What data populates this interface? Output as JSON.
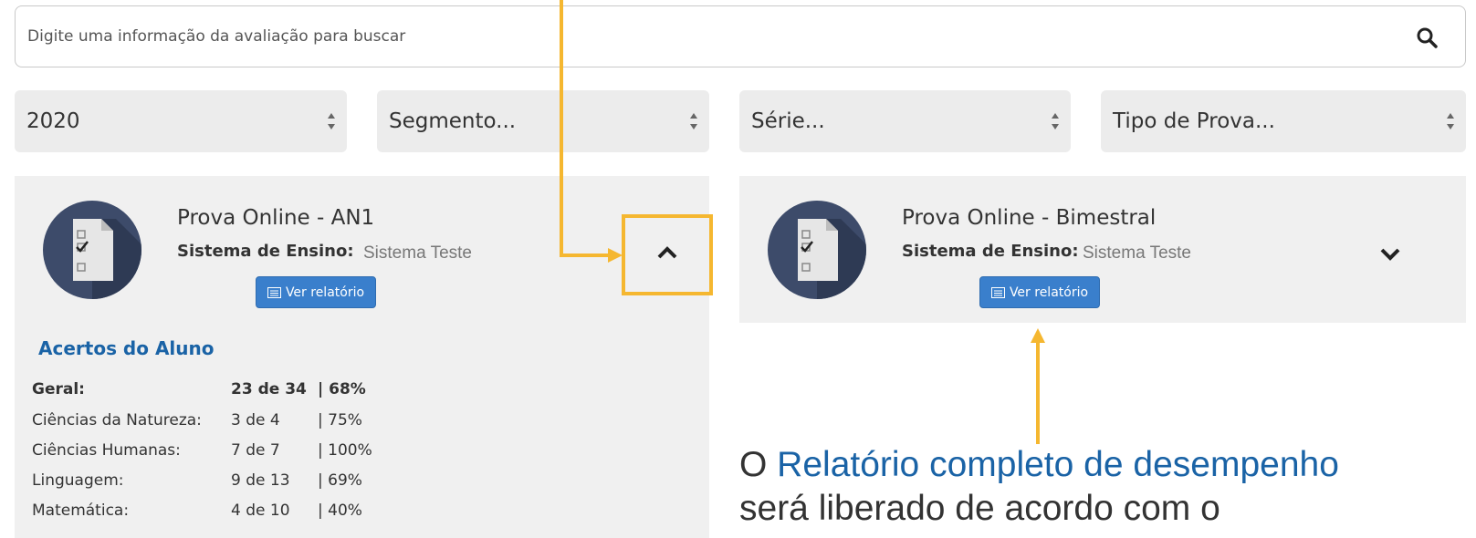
{
  "search": {
    "placeholder": "Digite uma informação da avaliação para buscar",
    "icon": "search-icon"
  },
  "filters": [
    {
      "value": "2020"
    },
    {
      "value": "Segmento..."
    },
    {
      "value": "Série..."
    },
    {
      "value": "Tipo de Prova..."
    }
  ],
  "cards": [
    {
      "title": "Prova Online - AN1",
      "system_label": "Sistema de Ensino:",
      "system_value": "Sistema Teste",
      "button_label": "Ver relatório",
      "toggle_icon": "chevron-up-icon",
      "stats": {
        "heading": "Acertos do Aluno",
        "rows": [
          {
            "label": "Geral:",
            "score": "23 de 34",
            "percent": "|  68%"
          },
          {
            "label": "Ciências da Natureza:",
            "score": "3 de 4",
            "percent": "| 75%"
          },
          {
            "label": "Ciências Humanas:",
            "score": "7 de 7",
            "percent": "| 100%"
          },
          {
            "label": "Linguagem:",
            "score": "9 de 13",
            "percent": "| 69%"
          },
          {
            "label": "Matemática:",
            "score": "4 de 10",
            "percent": "| 40%"
          }
        ]
      }
    },
    {
      "title": "Prova Online - Bimestral",
      "system_label": "Sistema de Ensino:",
      "system_value": "Sistema Teste",
      "button_label": "Ver relatório",
      "toggle_icon": "chevron-down-icon"
    }
  ],
  "annotation": {
    "prefix": "O ",
    "highlight": "Relatório completo de desempenho",
    "line2": "será liberado de acordo com o"
  },
  "colors": {
    "accent": "#1a63a6",
    "button": "#3a7fcc",
    "callout": "#f5b730",
    "card_bg": "#f0f0f0"
  }
}
